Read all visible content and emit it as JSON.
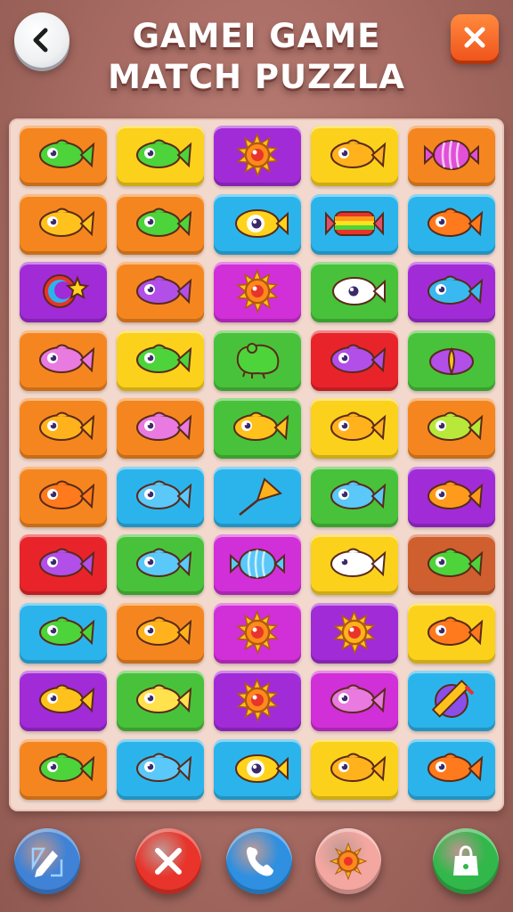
{
  "header": {
    "title_line1": "GAMEI GAME",
    "title_line2": "MATCH PUZZLA",
    "back_icon": "chevron-left-icon",
    "close_icon": "close-icon"
  },
  "colors": {
    "orange": "#f5861f",
    "yellow": "#fbd11c",
    "purple": "#a22bd8",
    "blue": "#2bb4ec",
    "green": "#48c23a",
    "red": "#e8242a",
    "magenta": "#d12fd8",
    "brown": "#cf5f2e"
  },
  "board": {
    "rows": [
      [
        {
          "color": "orange",
          "icon": "fish",
          "fill": "#4cd43a"
        },
        {
          "color": "yellow",
          "icon": "fish",
          "fill": "#4cd43a"
        },
        {
          "color": "purple",
          "icon": "sun",
          "fill": "#ff8a1c"
        },
        {
          "color": "yellow",
          "icon": "fish",
          "fill": "#ffb21c"
        },
        {
          "color": "orange",
          "icon": "candy",
          "fill": "#e24fd8"
        }
      ],
      [
        {
          "color": "orange",
          "icon": "fish",
          "fill": "#ffc21c"
        },
        {
          "color": "orange",
          "icon": "fish",
          "fill": "#4cd43a"
        },
        {
          "color": "blue",
          "icon": "eye-fish",
          "fill": "#ffd21c"
        },
        {
          "color": "blue",
          "icon": "rainbow-candy",
          "fill": "#e24f6a"
        },
        {
          "color": "blue",
          "icon": "fish",
          "fill": "#ff7a1c"
        }
      ],
      [
        {
          "color": "purple",
          "icon": "crescent",
          "fill": "#ffd21c"
        },
        {
          "color": "orange",
          "icon": "fish",
          "fill": "#b24fe8"
        },
        {
          "color": "magenta",
          "icon": "sun",
          "fill": "#ff8a1c"
        },
        {
          "color": "green",
          "icon": "eye-fish",
          "fill": "#ffffff"
        },
        {
          "color": "purple",
          "icon": "fish",
          "fill": "#3ab8f0"
        }
      ],
      [
        {
          "color": "orange",
          "icon": "fish",
          "fill": "#e97ae0"
        },
        {
          "color": "yellow",
          "icon": "fish",
          "fill": "#4cd43a"
        },
        {
          "color": "green",
          "icon": "blob",
          "fill": "#4cd43a"
        },
        {
          "color": "red",
          "icon": "fish",
          "fill": "#b24fe8"
        },
        {
          "color": "green",
          "icon": "shell",
          "fill": "#b24fe8"
        }
      ],
      [
        {
          "color": "orange",
          "icon": "fish",
          "fill": "#ffb21c"
        },
        {
          "color": "orange",
          "icon": "fish",
          "fill": "#e97ae0"
        },
        {
          "color": "green",
          "icon": "fish",
          "fill": "#ffc21c"
        },
        {
          "color": "yellow",
          "icon": "fish",
          "fill": "#ffb21c"
        },
        {
          "color": "orange",
          "icon": "fish",
          "fill": "#b8e83a"
        }
      ],
      [
        {
          "color": "orange",
          "icon": "fish",
          "fill": "#ff7a1c"
        },
        {
          "color": "blue",
          "icon": "fish",
          "fill": "#5ac8f8"
        },
        {
          "color": "blue",
          "icon": "kite",
          "fill": "#ffb21c"
        },
        {
          "color": "green",
          "icon": "fish",
          "fill": "#5ac8f8"
        },
        {
          "color": "purple",
          "icon": "fish",
          "fill": "#ff9a1c"
        }
      ],
      [
        {
          "color": "red",
          "icon": "fish",
          "fill": "#b24fe8"
        },
        {
          "color": "green",
          "icon": "fish",
          "fill": "#5ac8f8"
        },
        {
          "color": "magenta",
          "icon": "candy",
          "fill": "#5ac8f8"
        },
        {
          "color": "yellow",
          "icon": "fish",
          "fill": "#ffffff"
        },
        {
          "color": "brown",
          "icon": "fish",
          "fill": "#4cd43a"
        }
      ],
      [
        {
          "color": "blue",
          "icon": "fish",
          "fill": "#4cd43a"
        },
        {
          "color": "orange",
          "icon": "fish",
          "fill": "#ffb21c"
        },
        {
          "color": "magenta",
          "icon": "sun",
          "fill": "#ff8a1c"
        },
        {
          "color": "purple",
          "icon": "sun",
          "fill": "#ffb21c"
        },
        {
          "color": "yellow",
          "icon": "fish",
          "fill": "#ff7a1c"
        }
      ],
      [
        {
          "color": "purple",
          "icon": "fish",
          "fill": "#ffc21c"
        },
        {
          "color": "green",
          "icon": "fish",
          "fill": "#ffe24c"
        },
        {
          "color": "purple",
          "icon": "sun",
          "fill": "#ff8a1c"
        },
        {
          "color": "magenta",
          "icon": "fish",
          "fill": "#e97ae0"
        },
        {
          "color": "blue",
          "icon": "pencil",
          "fill": "#8a4fe8"
        }
      ],
      [
        {
          "color": "orange",
          "icon": "fish",
          "fill": "#4cd43a"
        },
        {
          "color": "blue",
          "icon": "fish",
          "fill": "#5ac8f8"
        },
        {
          "color": "blue",
          "icon": "eye-fish",
          "fill": "#ffd21c"
        },
        {
          "color": "yellow",
          "icon": "fish",
          "fill": "#ffb21c"
        },
        {
          "color": "blue",
          "icon": "fish",
          "fill": "#ff7a1c"
        }
      ]
    ]
  },
  "footer": {
    "buttons": [
      {
        "name": "pencil-button",
        "icon": "pencil-icon",
        "color": "#3f82d6"
      },
      {
        "name": "cancel-button",
        "icon": "close-icon",
        "color": "#e8342a"
      },
      {
        "name": "phone-button",
        "icon": "phone-icon",
        "color": "#2f8fe0"
      },
      {
        "name": "sun-button",
        "icon": "sun-icon",
        "color": "#f4a7a0"
      },
      {
        "name": "shop-button",
        "icon": "shopping-bag-icon",
        "color": "#32b84a"
      }
    ]
  }
}
